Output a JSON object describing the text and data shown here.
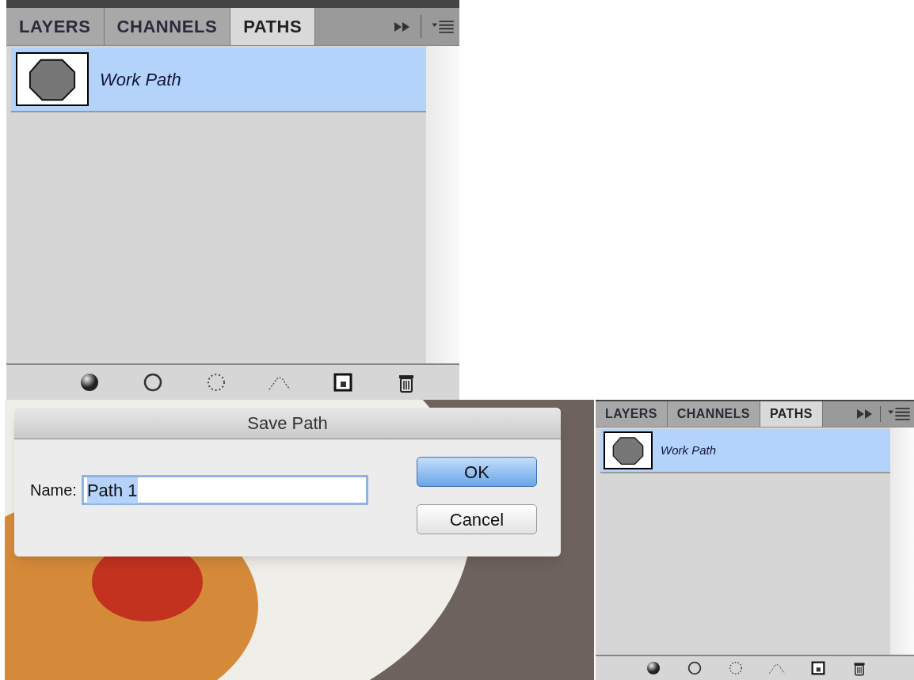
{
  "panels": [
    {
      "tabs": [
        {
          "label": "LAYERS",
          "selected": false
        },
        {
          "label": "CHANNELS",
          "selected": false
        },
        {
          "label": "PATHS",
          "selected": true
        }
      ],
      "paths": [
        {
          "name": "Work Path",
          "selected": true
        }
      ]
    },
    {
      "tabs": [
        {
          "label": "LAYERS",
          "selected": false
        },
        {
          "label": "CHANNELS",
          "selected": false
        },
        {
          "label": "PATHS",
          "selected": true
        }
      ],
      "paths": [
        {
          "name": "Work Path",
          "selected": true
        }
      ]
    }
  ],
  "dialog": {
    "title": "Save Path",
    "field_label": "Name:",
    "field_value": "Path 1",
    "buttons": [
      {
        "label": "OK",
        "default": true
      },
      {
        "label": "Cancel",
        "default": false
      }
    ]
  }
}
